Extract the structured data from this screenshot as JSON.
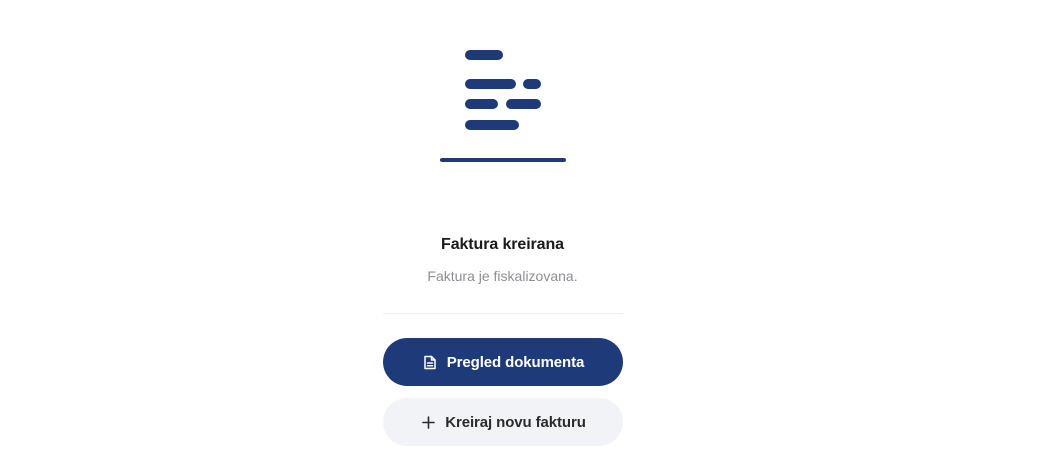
{
  "illustration": {
    "icon": "document-lines-icon",
    "color": "#1e3a78"
  },
  "status": {
    "title": "Faktura kreirana",
    "subtitle": "Faktura je fiskalizovana."
  },
  "actions": {
    "view_document_label": "Pregled dokumenta",
    "view_document_icon": "document-icon",
    "create_new_label": "Kreiraj novu fakturu",
    "create_new_icon": "plus-icon"
  },
  "colors": {
    "primary": "#1e3a78",
    "secondary_bg": "#f2f3f6",
    "title": "#1a1a1a",
    "subtitle": "#8e8e93"
  }
}
